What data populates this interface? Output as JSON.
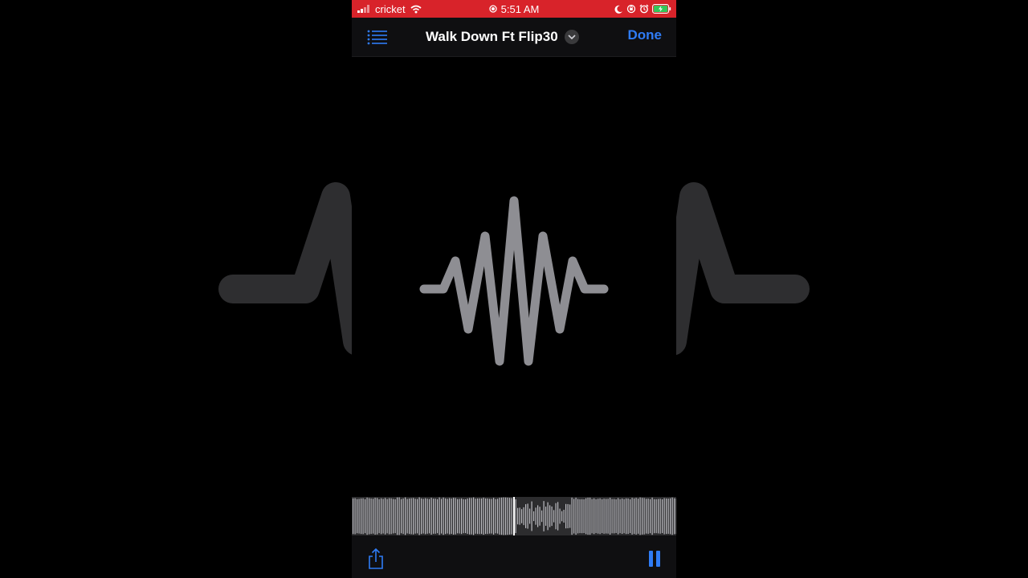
{
  "status_bar": {
    "carrier": "cricket",
    "time": "5:51 AM",
    "accent_color": "#d8232a"
  },
  "nav": {
    "list_icon": "list-icon",
    "title": "Walk Down Ft Flip30",
    "dropdown_icon": "chevron-down-icon",
    "done_label": "Done",
    "tint_color": "#2f7cf6"
  },
  "artwork": {
    "icon": "waveform-icon",
    "color": "#8e8e93"
  },
  "player": {
    "state": "playing",
    "share_icon": "share-icon",
    "pause_icon": "pause-icon"
  }
}
